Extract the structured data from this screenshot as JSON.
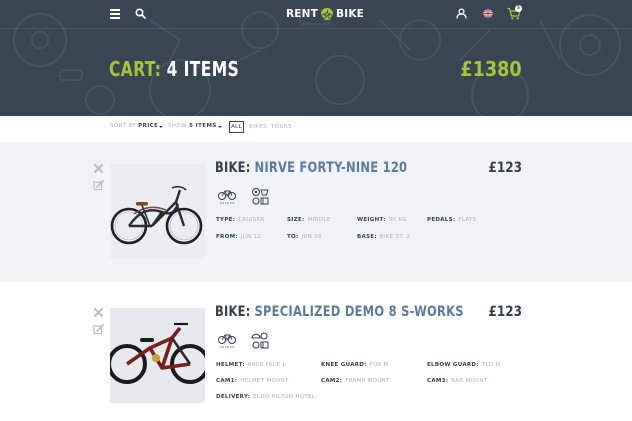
{
  "header": {
    "logo_left": "RENT",
    "logo_right": "BIKE",
    "cart_count": "5",
    "icons": [
      "menu-icon",
      "search-icon",
      "logo-mark-icon",
      "user-icon",
      "uk-flag-icon",
      "cart-icon"
    ]
  },
  "hero": {
    "title_keyword": "CART:",
    "title_count": "4 ITEMS",
    "total": "£1380"
  },
  "filters": {
    "sort_label": "SORT BY",
    "sort_value": "PRICE",
    "show_label": "SHOW",
    "show_value": "5 ITEMS",
    "tabs": [
      "ALL",
      "BIKES",
      "TOURS"
    ],
    "active_tab": "ALL"
  },
  "colors": {
    "hero_bg": "#3a4553",
    "accent": "#a4c639",
    "item_name": "#5c7a9c"
  },
  "items": [
    {
      "keyword": "BIKE:",
      "name": "NIRVE FORTY-NINE 120",
      "price": "£123",
      "feature_icons": [
        "bicycle-icon",
        "gear-icon"
      ],
      "specs": [
        {
          "label": "TYPE:",
          "value": "CRUISER"
        },
        {
          "label": "SIZE:",
          "value": "MIDDLE"
        },
        {
          "label": "WEIGHT:",
          "value": "90 KG"
        },
        {
          "label": "PEDALS:",
          "value": "FLATS"
        },
        {
          "label": "FROM:",
          "value": "JUN 12"
        },
        {
          "label": "TO:",
          "value": "JUN 16"
        },
        {
          "label": "BASE:",
          "value": "BIKE ST. 2"
        }
      ]
    },
    {
      "keyword": "BIKE:",
      "name": "SPECIALIZED DEMO 8 S-WORKS",
      "price": "£123",
      "feature_icons": [
        "bicycle-icon",
        "protection-gear-icon"
      ],
      "specs": [
        {
          "label": "HELMET:",
          "value": "RACE FACE L"
        },
        {
          "label": "KNEE GUARD:",
          "value": "FOX M"
        },
        {
          "label": "ELBOW GUARD:",
          "value": "TLD M"
        },
        {
          "label": "CAM1:",
          "value": "HELMET MOUNT"
        },
        {
          "label": "CAM2:",
          "value": "FRAME MOUNT"
        },
        {
          "label": "CAM3:",
          "value": "BAR MOUNT"
        },
        {
          "label": "DELIVERY:",
          "value": "ELDO HILTON HOTEL"
        }
      ]
    }
  ]
}
